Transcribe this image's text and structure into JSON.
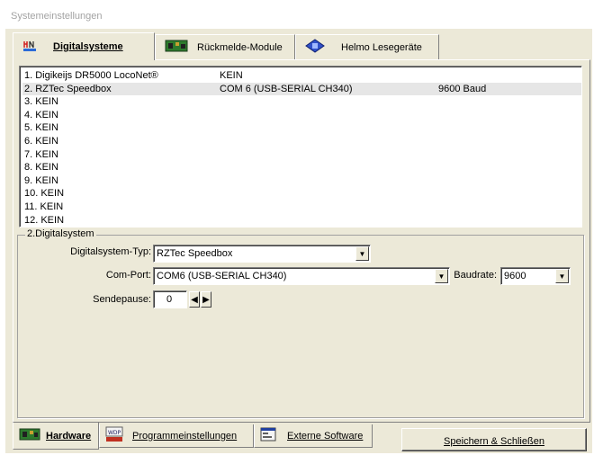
{
  "window": {
    "title": "Systemeinstellungen"
  },
  "top_tabs": [
    {
      "label": "Digitalsysteme",
      "icon": "circuit-board-icon",
      "active": true
    },
    {
      "label": "Rückmelde-Module",
      "icon": "feedback-module-icon",
      "active": false
    },
    {
      "label": "Helmo Lesegeräte",
      "icon": "reader-device-icon",
      "active": false
    }
  ],
  "systems_list": [
    {
      "name": "1. Digikeijs DR5000 LocoNet®",
      "port": "KEIN",
      "baud": ""
    },
    {
      "name": "2. RZTec Speedbox",
      "port": "COM 6 (USB-SERIAL CH340)",
      "baud": "9600 Baud"
    },
    {
      "name": "3. KEIN",
      "port": "",
      "baud": ""
    },
    {
      "name": "4. KEIN",
      "port": "",
      "baud": ""
    },
    {
      "name": "5. KEIN",
      "port": "",
      "baud": ""
    },
    {
      "name": "6. KEIN",
      "port": "",
      "baud": ""
    },
    {
      "name": "7. KEIN",
      "port": "",
      "baud": ""
    },
    {
      "name": "8. KEIN",
      "port": "",
      "baud": ""
    },
    {
      "name": "9. KEIN",
      "port": "",
      "baud": ""
    },
    {
      "name": "10. KEIN",
      "port": "",
      "baud": ""
    },
    {
      "name": "11. KEIN",
      "port": "",
      "baud": ""
    },
    {
      "name": "12. KEIN",
      "port": "",
      "baud": ""
    }
  ],
  "digitalsystem_group": {
    "legend": "2.Digitalsystem",
    "type_label": "Digitalsystem-Typ:",
    "type_value": "RZTec Speedbox",
    "comport_label": "Com-Port:",
    "comport_value": "COM6 (USB-SERIAL CH340)",
    "baud_label": "Baudrate:",
    "baud_value": "9600",
    "sendepause_label": "Sendepause:",
    "sendepause_value": "0"
  },
  "bottom_tabs": [
    {
      "label": "Hardware",
      "icon": "hardware-board-icon",
      "active": true
    },
    {
      "label": "Programmeinstellungen",
      "icon": "wdp-settings-icon",
      "active": false
    },
    {
      "label": "Externe Software",
      "icon": "external-software-icon",
      "active": false
    }
  ],
  "save_button": "Speichern & Schließen",
  "colors": {
    "background": "#ece9d8",
    "list_selected": "#e6e6e6"
  }
}
